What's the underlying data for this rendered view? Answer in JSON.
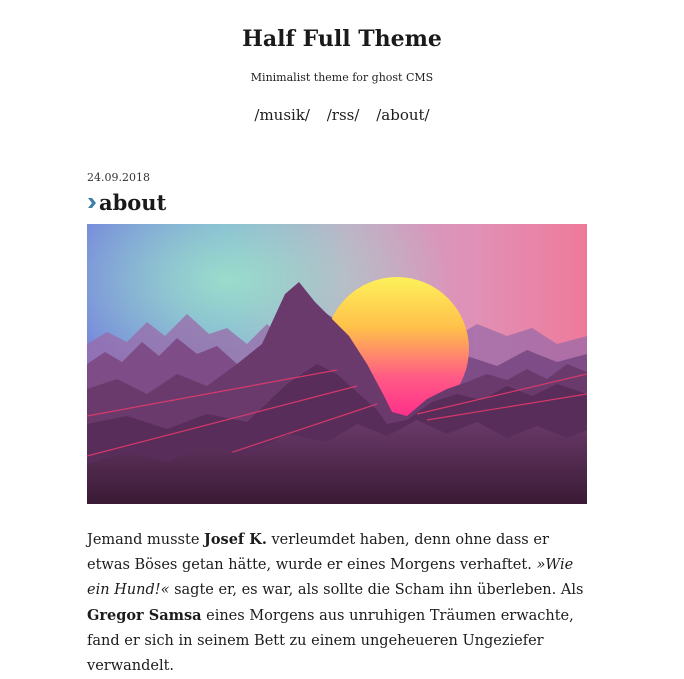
{
  "site": {
    "title": "Half Full Theme",
    "tagline": "Minimalist theme for ghost CMS"
  },
  "nav": {
    "items": [
      {
        "label": "/musik/"
      },
      {
        "label": "/rss/"
      },
      {
        "label": "/about/"
      }
    ]
  },
  "post": {
    "date": "24.09.2018",
    "title": "about",
    "image_icon": "sunset-mountains-image",
    "body": {
      "t1": "Jemand musste ",
      "b1": "Josef K.",
      "t2": " verleumdet haben, denn ohne dass er etwas Böses getan hätte, wurde er eines Morgens verhaftet. ",
      "i1": "»Wie ein Hund!«",
      "t3": " sagte er, es war, als sollte die Scham ihn überleben. Als ",
      "b2": "Gregor Samsa",
      "t4": " eines Morgens aus unruhigen Träumen erwachte, fand er sich in seinem Bett zu einem ungeheueren Ungeziefer verwandelt."
    }
  },
  "colors": {
    "marker": "#3d7fa6",
    "text": "#1c1c1c"
  }
}
